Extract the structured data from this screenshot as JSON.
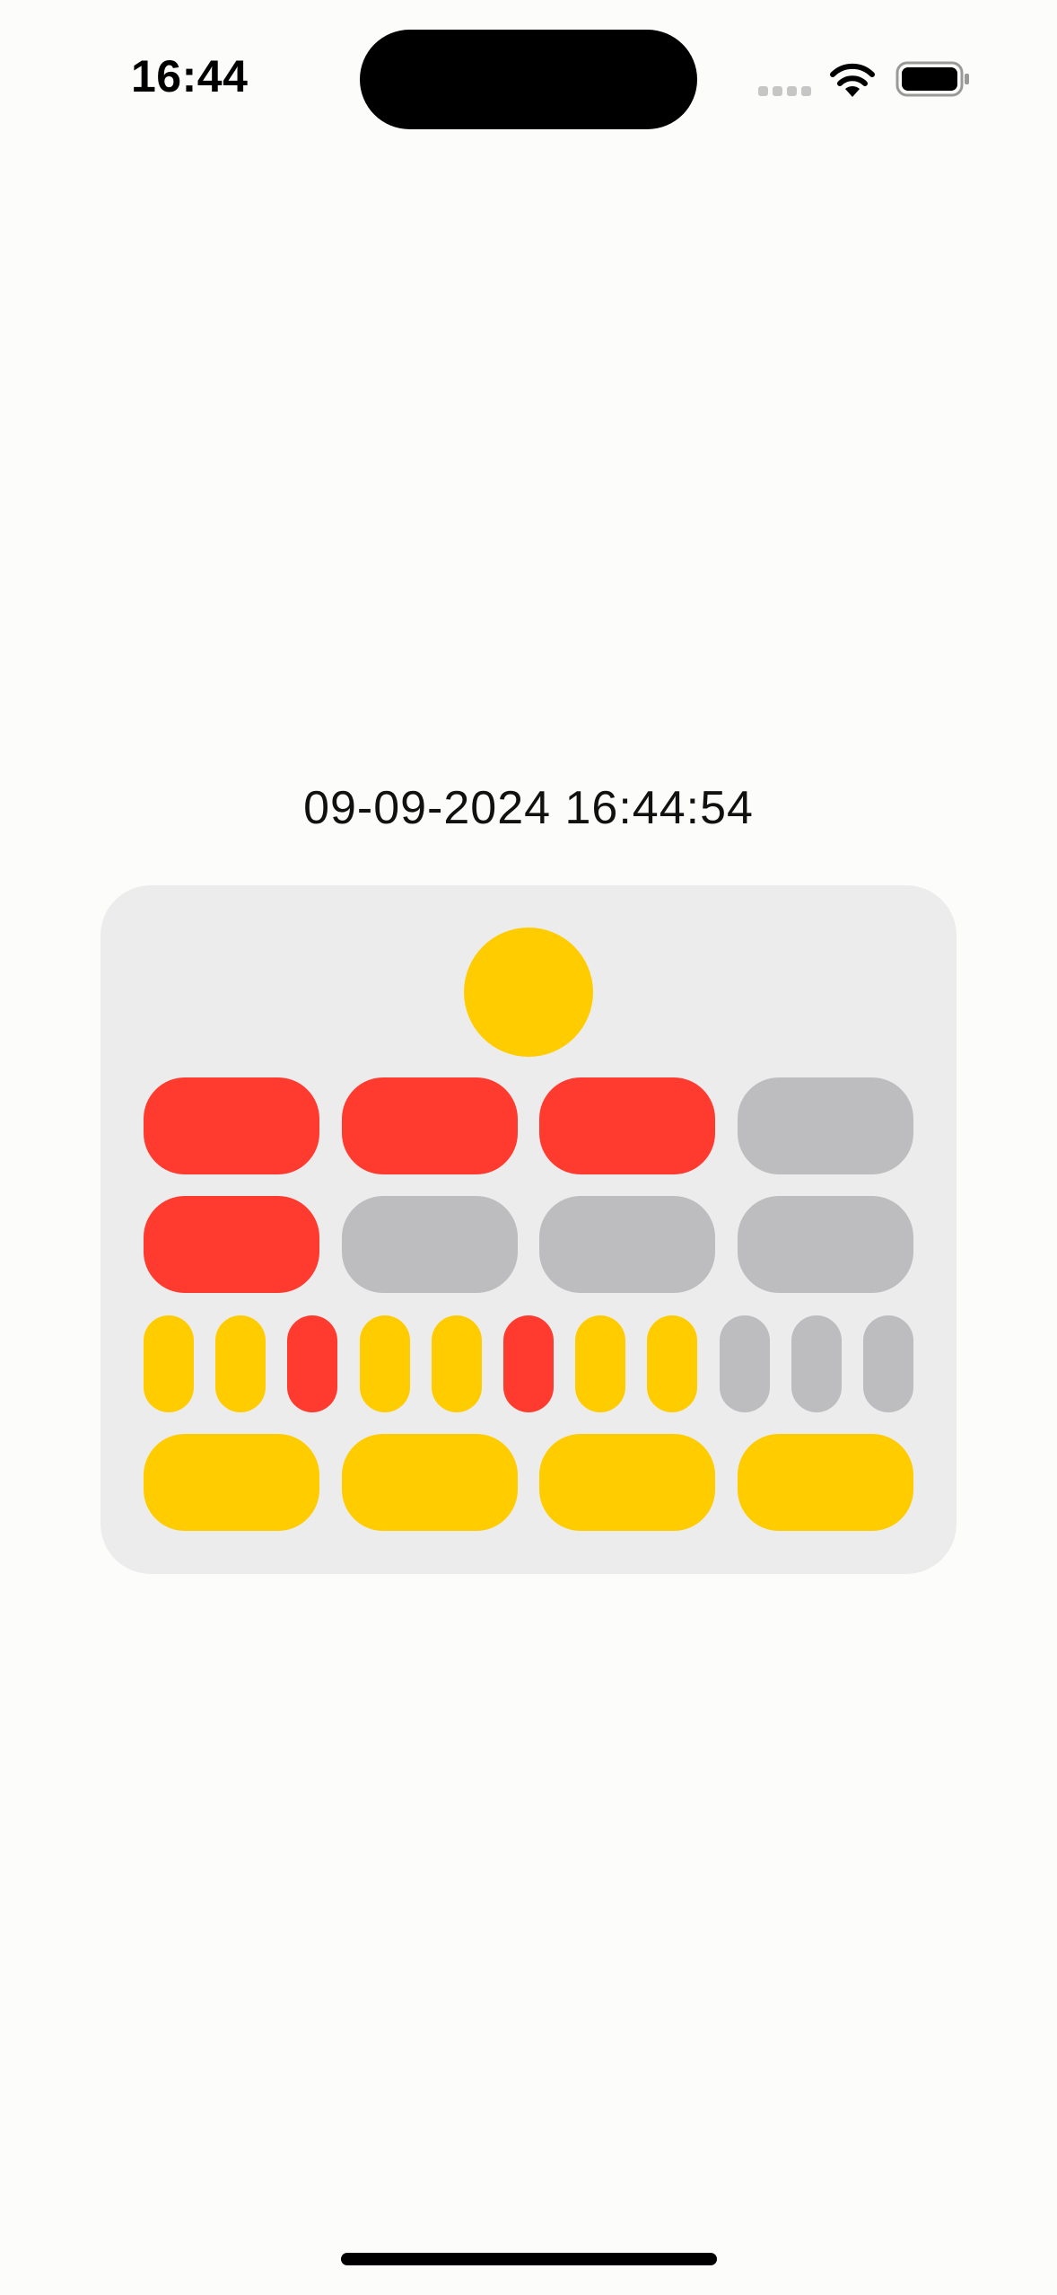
{
  "status_bar": {
    "time": "16:44",
    "icons": {
      "signal": "cellular-signal-icon",
      "wifi": "wifi-icon",
      "battery": "battery-icon"
    }
  },
  "datetime": "09-09-2024 16:44:54",
  "colors": {
    "on_red": "#ff3b30",
    "on_yellow": "#ffcc00",
    "off": "#bdbdbf",
    "card_background": "#ececec",
    "page_background": "#fcfcfb"
  },
  "berlin_clock": {
    "seconds_lamp": {
      "state": "on",
      "color": "yellow"
    },
    "five_hour_row": [
      "red",
      "red",
      "red",
      "off"
    ],
    "one_hour_row": [
      "red",
      "off",
      "off",
      "off"
    ],
    "five_minute_row": [
      "yellow",
      "yellow",
      "red",
      "yellow",
      "yellow",
      "red",
      "yellow",
      "yellow",
      "off",
      "off",
      "off"
    ],
    "one_minute_row": [
      "yellow",
      "yellow",
      "yellow",
      "yellow"
    ]
  }
}
